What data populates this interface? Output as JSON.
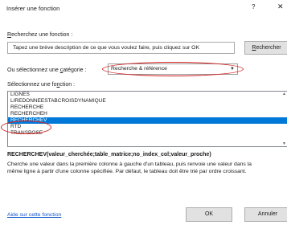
{
  "dialog": {
    "title": "Insérer une fonction",
    "help_glyph": "?",
    "close_glyph": "✕"
  },
  "search": {
    "label_accesskey": "R",
    "label_rest": "echerchez une fonction :",
    "value": "Tapez une brève description de ce que vous voulez faire, puis cliquez sur OK",
    "button_pre": "R",
    "button_rest": "echercher"
  },
  "category": {
    "label_pre": "Ou sélectionnez une ",
    "label_accesskey": "c",
    "label_rest": "atégorie :",
    "selected": "Recherche & référence",
    "arrow_icon": "chevron-down-icon"
  },
  "functions": {
    "label_pre": "Sélectionnez une fo",
    "label_accesskey": "n",
    "label_rest": "ction :",
    "items": [
      "LIGNES",
      "LIREDONNEESTABCROISDYNAMIQUE",
      "RECHERCHE",
      "RECHERCHEH",
      "RECHERCHEV",
      "RTD",
      "TRANSPOSE"
    ],
    "selected_index": 4
  },
  "details": {
    "syntax": "RECHERCHEV(valeur_cherchée;table_matrice;no_index_col;valeur_proche)",
    "line1": "Cherche une valeur dans la première colonne à gauche d'un tableau, puis renvoie une valeur dans la",
    "line2": "même ligne à partir d'une colonne spécifiée. Par défaut, le tableau doit être trié par ordre croissant."
  },
  "footer": {
    "help_link": "Aide sur cette fonction",
    "ok": "OK",
    "cancel": "Annuler"
  },
  "colors": {
    "selection": "#0078d7",
    "annotation": "#d42020",
    "link": "#1155cc"
  }
}
